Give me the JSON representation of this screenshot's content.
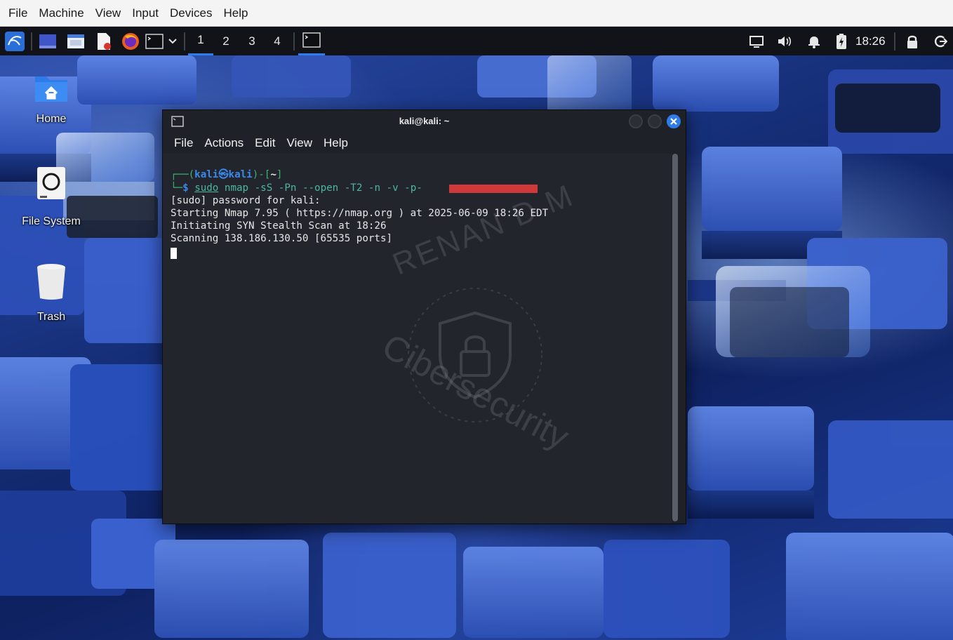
{
  "vbox_menu": [
    "File",
    "Machine",
    "View",
    "Input",
    "Devices",
    "Help"
  ],
  "panel": {
    "workspaces": [
      "1",
      "2",
      "3",
      "4"
    ],
    "active_workspace": "1",
    "clock": "18:26"
  },
  "desktop_icons": [
    {
      "label": "Home",
      "icon": "home-folder-icon"
    },
    {
      "label": "File System",
      "icon": "hard-drive-icon"
    },
    {
      "label": "Trash",
      "icon": "trash-icon"
    }
  ],
  "terminal": {
    "title": "kali@kali: ~",
    "menu": [
      "File",
      "Actions",
      "Edit",
      "View",
      "Help"
    ],
    "prompt_user": "kali",
    "prompt_host": "kali",
    "prompt_dir": "~",
    "command_sudo": "sudo",
    "command_rest": "nmap -sS -Pn --open -T2 -n -v -p-",
    "output": [
      "[sudo] password for kali:",
      "Starting Nmap 7.95 ( https://nmap.org ) at 2025-06-09 18:26 EDT",
      "Initiating SYN Stealth Scan at 18:26",
      "Scanning 138.186.130.50 [65535 ports]"
    ],
    "watermark_top": "RENAN D M",
    "watermark_bottom": "Cibersecurity"
  },
  "colors": {
    "panel_bg": "#111318",
    "accent": "#2f7be8",
    "terminal_bg": "#22252c",
    "prompt_blue": "#3a88ea",
    "redaction": "#d0393a"
  }
}
